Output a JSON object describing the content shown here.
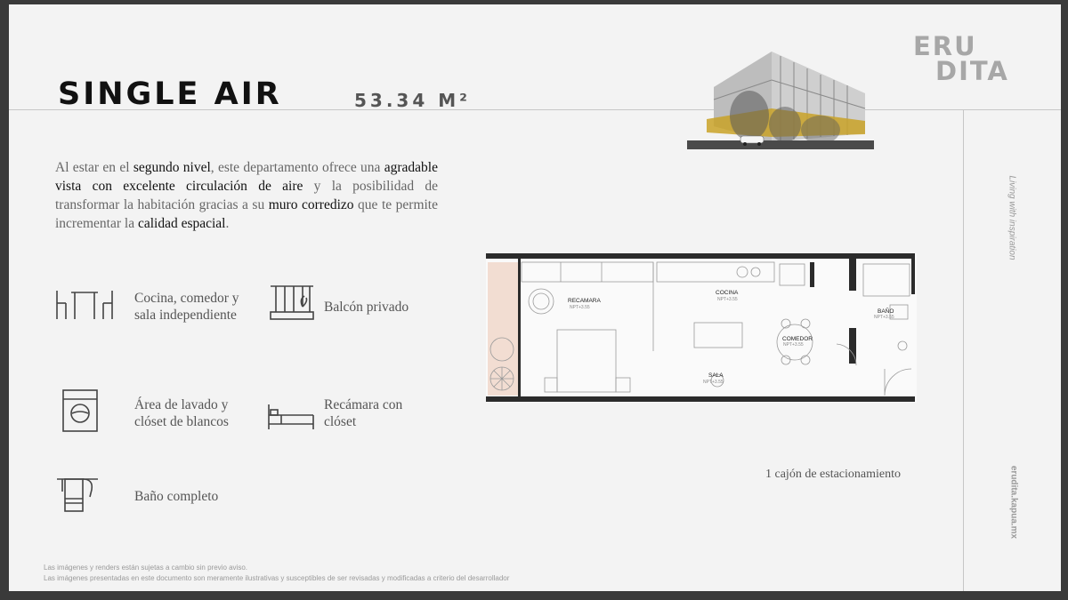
{
  "logo": {
    "line1": "ERU",
    "line2": "DITA"
  },
  "title": "SINGLE AIR",
  "area": "53.34 M²",
  "description": [
    {
      "t": "Al estar en el ",
      "em": false
    },
    {
      "t": "segundo nivel",
      "em": true
    },
    {
      "t": ", este departamento ofrece una ",
      "em": false
    },
    {
      "t": "agradable vista con excelente circulación de aire",
      "em": true
    },
    {
      "t": " y la posibilidad de transformar la habitación gracias a su ",
      "em": false
    },
    {
      "t": "muro corredizo",
      "em": true
    },
    {
      "t": " que te permite incrementar la ",
      "em": false
    },
    {
      "t": "calidad espacial",
      "em": true
    },
    {
      "t": ".",
      "em": false
    }
  ],
  "features": {
    "kitchen": {
      "line1": "Cocina, comedor y",
      "line2": "sala independiente",
      "icon": "dining-table-icon"
    },
    "balcony": {
      "line1": "Balcón privado",
      "icon": "balcony-icon"
    },
    "laundry": {
      "line1": "Área de lavado y",
      "line2": "clóset de blancos",
      "icon": "washing-machine-icon"
    },
    "bedroom": {
      "line1": "Recámara con",
      "line2": "clóset",
      "icon": "bed-icon"
    },
    "bath": {
      "line1": "Baño completo",
      "icon": "towel-rack-icon"
    }
  },
  "plan_labels": {
    "recamara": "RECAMARA",
    "cocina": "COCINA",
    "comedor": "COMEDOR",
    "sala": "SALA",
    "bano": "BAÑO",
    "npt": "NPT+3.55"
  },
  "parking": "1 cajón de estacionamiento",
  "side_text": "Living with inspiration",
  "side_url": "erudita.kapua.mx",
  "disclaimer1": "Las imágenes y renders están sujetas a cambio sin previo aviso.",
  "disclaimer2": "Las imágenes presentadas en este documento son meramente ilustrativas y susceptibles de ser revisadas y modificadas a criterio del desarrollador",
  "colors": {
    "accent_yellow": "#c9a227",
    "balcony_tint": "#f2ddd2",
    "wall": "#2b2b2b"
  }
}
